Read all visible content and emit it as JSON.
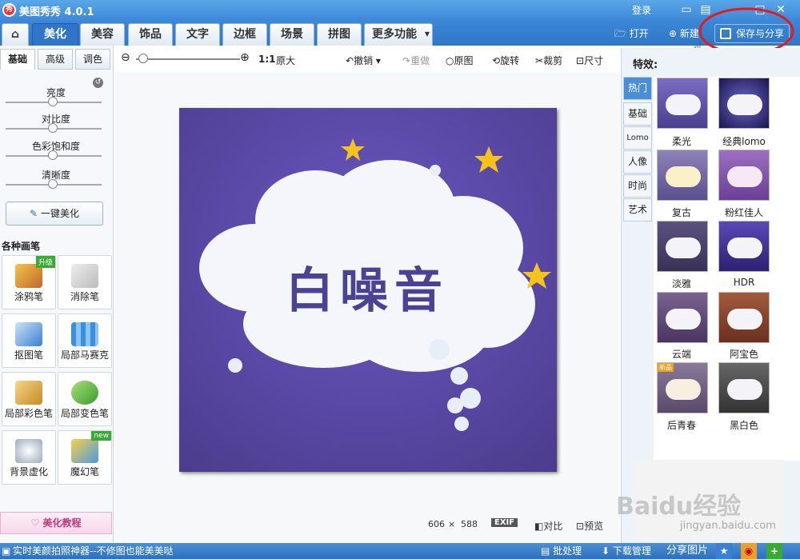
{
  "app": {
    "title": "美图秀秀 4.0.1",
    "logo_text": "秀",
    "login": "登录"
  },
  "nav": {
    "tabs": [
      "美化",
      "美容",
      "饰品",
      "文字",
      "边框",
      "场景",
      "拼图",
      "更多功能"
    ],
    "active": "美化",
    "open": "打开",
    "new": "新建",
    "save": "保存与分享"
  },
  "toolbar": {
    "ratio": "1:1",
    "original_size": "原大",
    "undo": "撤销",
    "redo": "重做",
    "original": "原图",
    "rotate": "旋转",
    "crop": "裁剪",
    "resize": "尺寸"
  },
  "left": {
    "subtabs": [
      "基础",
      "高级",
      "调色"
    ],
    "sliders": [
      "亮度",
      "对比度",
      "色彩饱和度",
      "清晰度"
    ],
    "one_key": "一键美化",
    "brush_heading": "各种画笔",
    "brushes": [
      {
        "label": "涂鸦笔",
        "badge": "升级"
      },
      {
        "label": "消除笔",
        "badge": ""
      },
      {
        "label": "抠图笔",
        "badge": ""
      },
      {
        "label": "局部马赛克",
        "badge": ""
      },
      {
        "label": "局部彩色笔",
        "badge": ""
      },
      {
        "label": "局部变色笔",
        "badge": ""
      },
      {
        "label": "背景虚化",
        "badge": ""
      },
      {
        "label": "魔幻笔",
        "badge": "new"
      }
    ],
    "tutorial": "美化教程"
  },
  "canvas": {
    "image_text": "白噪音",
    "width": "606",
    "x": "×",
    "height": "588",
    "exif": "EXIF",
    "compare": "对比",
    "preview": "预览"
  },
  "effects": {
    "heading": "特效:",
    "categories": [
      "热门",
      "基础",
      "Lomo",
      "人像",
      "时尚",
      "艺术"
    ],
    "items": [
      "柔光",
      "经典lomo",
      "复古",
      "粉红佳人",
      "淡雅",
      "HDR",
      "云端",
      "阿宝色",
      "后青春",
      "黑白色"
    ],
    "thumb_text": "白噪音",
    "tag": "新品"
  },
  "status": {
    "tip": "实时美颜拍照神器--不修图也能美美哒",
    "batch": "批处理",
    "download": "下载管理",
    "share": "分享图片"
  },
  "watermark": {
    "line1": "Baidu经验",
    "line2": "jingyan.baidu.com"
  }
}
